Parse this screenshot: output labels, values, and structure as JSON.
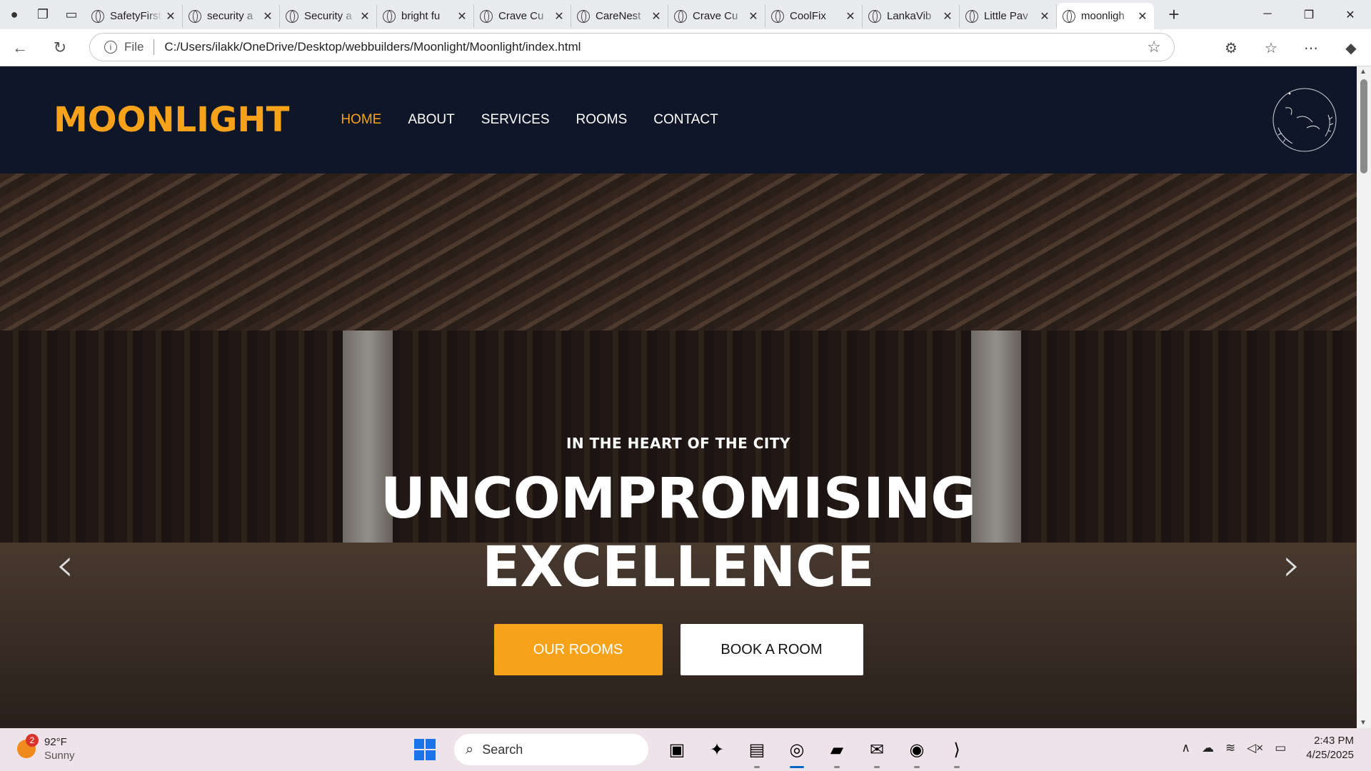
{
  "browser": {
    "tabs": [
      {
        "title": "SafetyFirst"
      },
      {
        "title": "security a"
      },
      {
        "title": "Security a"
      },
      {
        "title": "bright fu"
      },
      {
        "title": "Crave Cu"
      },
      {
        "title": "CareNest"
      },
      {
        "title": "Crave Cu"
      },
      {
        "title": "CoolFix"
      },
      {
        "title": "LankaVib"
      },
      {
        "title": "Little Pav"
      },
      {
        "title": "moonligh"
      }
    ],
    "url_scheme_label": "File",
    "url": "C:/Users/ilakk/OneDrive/Desktop/webbuilders/Moonlight/Moonlight/index.html"
  },
  "site": {
    "logo": "MOONLIGHT",
    "menu": [
      "HOME",
      "ABOUT",
      "SERVICES",
      "ROOMS",
      "CONTACT"
    ],
    "active_menu": "HOME",
    "accent_color": "#f7a21b",
    "header_bg": "#0e1628",
    "hero": {
      "kicker": "IN THE HEART OF THE CITY",
      "title_line1": "UNCOMPROMISING",
      "title_line2": "EXCELLENCE",
      "btn_primary": "OUR ROOMS",
      "btn_secondary": "BOOK A ROOM"
    }
  },
  "taskbar": {
    "weather_temp": "92°F",
    "weather_cond": "Sunny",
    "weather_badge": "2",
    "search_placeholder": "Search",
    "time": "2:43 PM",
    "date": "4/25/2025"
  }
}
